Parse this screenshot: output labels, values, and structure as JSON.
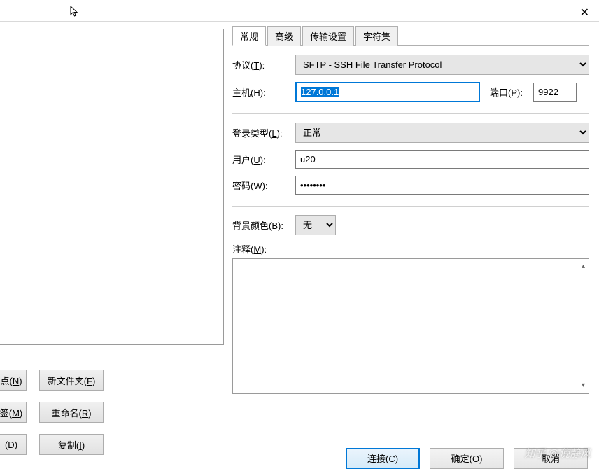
{
  "tabs": {
    "general": "常规",
    "advanced": "高级",
    "transfer": "传输设置",
    "charset": "字符集"
  },
  "labels": {
    "protocol": "协议",
    "protocol_key": "T",
    "host": "主机",
    "host_key": "H",
    "port": "端口",
    "port_key": "P",
    "logintype": "登录类型",
    "logintype_key": "L",
    "user": "用户",
    "user_key": "U",
    "password": "密码",
    "password_key": "W",
    "bgcolor": "背景颜色",
    "bgcolor_key": "B",
    "notes": "注释",
    "notes_key": "M"
  },
  "values": {
    "protocol": "SFTP - SSH File Transfer Protocol",
    "host": "127.0.0.1",
    "port": "9922",
    "logintype": "正常",
    "user": "u20",
    "password": "••••••••",
    "bgcolor": "无",
    "notes": ""
  },
  "left_buttons": {
    "site_suffix": "点",
    "site_key": "N",
    "newfolder": "新文件夹",
    "newfolder_key": "F",
    "bookmark_suffix": "签",
    "bookmark_key": "M",
    "rename": "重命名",
    "rename_key": "R",
    "delete_key": "D",
    "copy": "复制",
    "copy_key": "I"
  },
  "bottom_buttons": {
    "connect": "连接",
    "connect_key": "C",
    "ok": "确定",
    "ok_key": "O",
    "cancel": "取消"
  },
  "watermark": "知乎 @倪静风"
}
